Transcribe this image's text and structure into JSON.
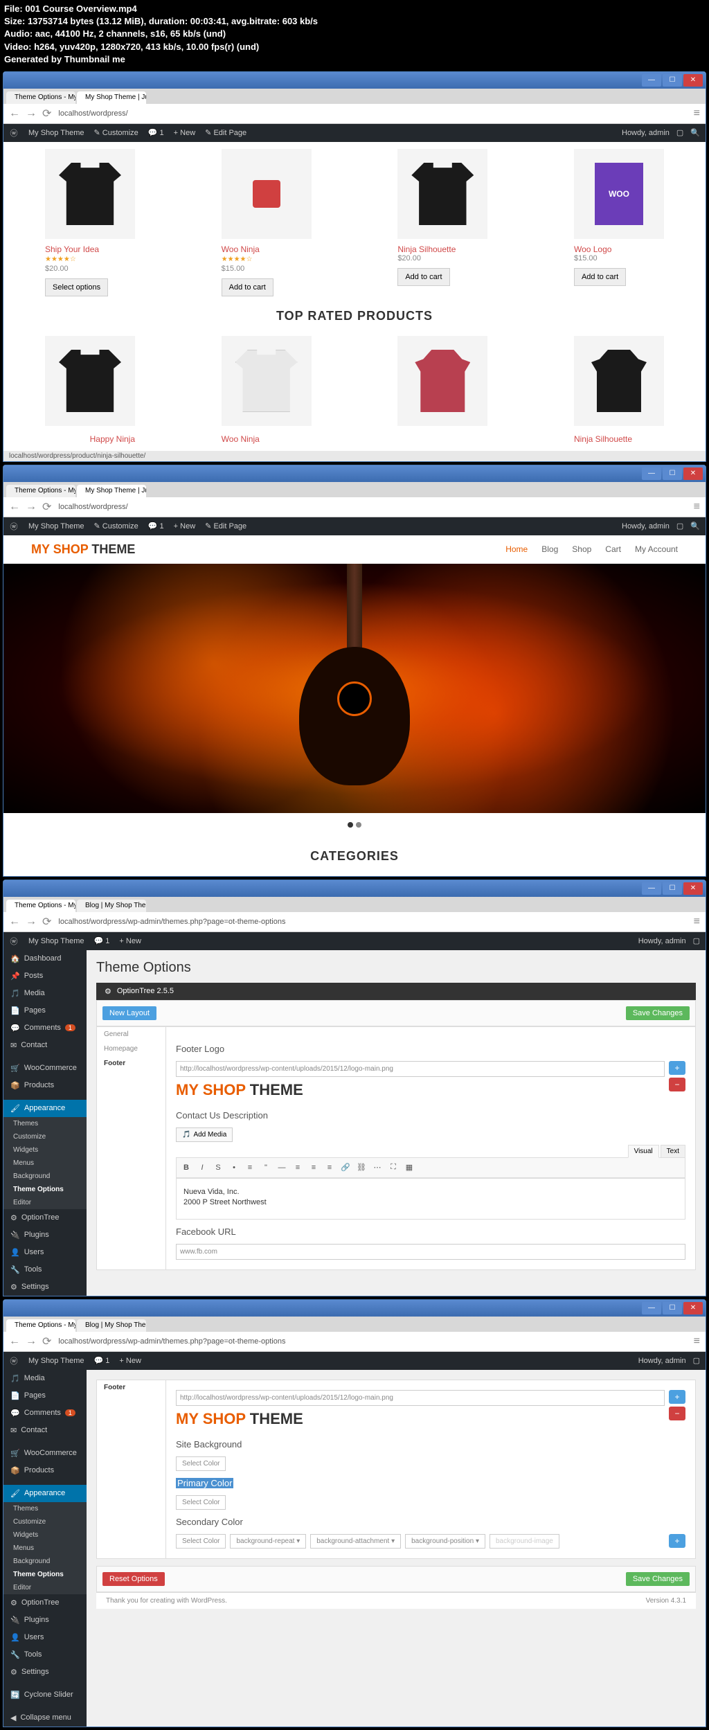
{
  "file_info": {
    "line1": "File: 001 Course Overview.mp4",
    "line2": "Size: 13753714 bytes (13.12 MiB), duration: 00:03:41, avg.bitrate: 603 kb/s",
    "line3": "Audio: aac, 44100 Hz, 2 channels, s16, 65 kb/s (und)",
    "line4": "Video: h264, yuv420p, 1280x720, 413 kb/s, 10.00 fps(r) (und)",
    "line5": "Generated by Thumbnail me"
  },
  "browser": {
    "tab1": "Theme Options - My",
    "tab2": "My Shop Theme | Ju...",
    "tab3": "Blog | My Shop The...",
    "addr1": "localhost/wordpress/",
    "addr2": "localhost/wordpress/wp-admin/themes.php?page=ot-theme-options",
    "status": "localhost/wordpress/product/ninja-silhouette/"
  },
  "wpbar": {
    "site": "My Shop Theme",
    "customize": "Customize",
    "comments": "1",
    "new": "New",
    "edit": "Edit Page",
    "howdy": "Howdy, admin"
  },
  "shop": {
    "products": [
      {
        "name": "Ship Your Idea",
        "stars": "★★★★☆",
        "price": "$20.00",
        "btn": "Select options"
      },
      {
        "name": "Woo Ninja",
        "stars": "★★★★☆",
        "price": "$15.00",
        "btn": "Add to cart"
      },
      {
        "name": "Ninja Silhouette",
        "stars": "",
        "price": "$20.00",
        "btn": "Add to cart"
      },
      {
        "name": "Woo Logo",
        "stars": "",
        "price": "$15.00",
        "btn": "Add to cart"
      }
    ],
    "section_top": "TOP RATED PRODUCTS",
    "top_products": [
      {
        "name": "Happy Ninja"
      },
      {
        "name": "Woo Ninja"
      },
      {
        "name": "Ninja Silhouette"
      }
    ],
    "logo_my": "MY ",
    "logo_shop": "SHOP ",
    "logo_theme": "THEME",
    "nav": [
      "Home",
      "Blog",
      "Shop",
      "Cart",
      "My Account"
    ],
    "categories": "CATEGORIES",
    "woo": "WOO"
  },
  "admin": {
    "title": "Theme Options",
    "ot_ver": "OptionTree 2.5.5",
    "new_layout": "New Layout",
    "save": "Save Changes",
    "reset": "Reset Options",
    "tabs": [
      "General",
      "Homepage",
      "Footer"
    ],
    "footer_logo": "Footer Logo",
    "logo_url": "http://localhost/wordpress/wp-content/uploads/2015/12/logo-main.png",
    "contact_label": "Contact Us Description",
    "add_media": "Add Media",
    "visual": "Visual",
    "text": "Text",
    "addr_line1": "Nueva Vida, Inc.",
    "addr_line2": "2000 P Street Northwest",
    "fb_label": "Facebook URL",
    "fb_val": "www.fb.com",
    "site_bg": "Site Background",
    "select_color": "Select Color",
    "primary": "Primary Color",
    "secondary": "Secondary Color",
    "bg_repeat": "background-repeat",
    "bg_attach": "background-attachment",
    "bg_pos": "background-position",
    "bg_img": "background-image",
    "thank": "Thank you for creating with WordPress.",
    "version": "Version 4.3.1"
  },
  "sidebar": {
    "items": [
      "Dashboard",
      "Posts",
      "Media",
      "Pages",
      "Comments",
      "Contact",
      "WooCommerce",
      "Products",
      "Appearance",
      "OptionTree",
      "Plugins",
      "Users",
      "Tools",
      "Settings"
    ],
    "sub": [
      "Themes",
      "Customize",
      "Widgets",
      "Menus",
      "Background",
      "Theme Options",
      "Editor"
    ],
    "cyclone": "Cyclone Slider",
    "collapse": "Collapse menu"
  }
}
